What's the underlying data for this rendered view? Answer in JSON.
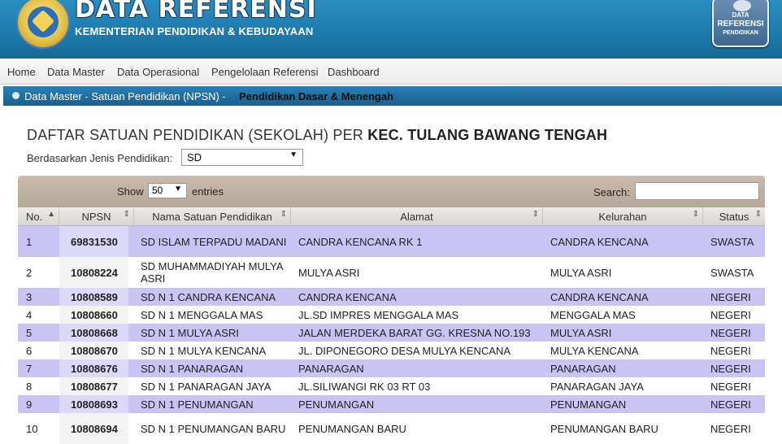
{
  "header": {
    "title": "DATA REFERENSI",
    "subtitle": "KEMENTERIAN PENDIDIKAN & KEBUDAYAAN",
    "badge": {
      "line1": "DATA",
      "line2": "REFERENSI",
      "line3": "PENDIDIKAN"
    }
  },
  "nav": {
    "items": [
      "Home",
      "Data Master",
      "Data Operasional",
      "Pengelolaan Referensi",
      "Dashboard"
    ]
  },
  "breadcrumb": {
    "path": "Data Master - Satuan Pendidikan (NPSN) -",
    "current": "Pendidikan Dasar & Menengah"
  },
  "page": {
    "title_prefix": "DAFTAR SATUAN PENDIDIKAN (SEKOLAH) PER",
    "title_strong": "KEC. TULANG BAWANG TENGAH",
    "filter_label": "Berdasarkan Jenis Pendidikan:",
    "filter_value": "SD"
  },
  "table_controls": {
    "show_label": "Show",
    "show_value": "50",
    "entries_label": "entries",
    "search_label": "Search:",
    "search_value": ""
  },
  "table": {
    "headers": [
      "No.",
      "NPSN",
      "Nama Satuan Pendidikan",
      "Alamat",
      "Kelurahan",
      "Status"
    ],
    "rows": [
      {
        "no": "1",
        "npsn": "69831530",
        "nama": "SD ISLAM TERPADU MADANI",
        "alamat": "CANDRA KENCANA RK 1",
        "kelurahan": "CANDRA KENCANA",
        "status": "SWASTA"
      },
      {
        "no": "2",
        "npsn": "10808224",
        "nama": "SD MUHAMMADIYAH MULYA ASRI",
        "alamat": "MULYA ASRI",
        "kelurahan": "MULYA ASRI",
        "status": "SWASTA"
      },
      {
        "no": "3",
        "npsn": "10808589",
        "nama": "SD N 1 CANDRA KENCANA",
        "alamat": "CANDRA KENCANA",
        "kelurahan": "CANDRA KENCANA",
        "status": "NEGERI"
      },
      {
        "no": "4",
        "npsn": "10808660",
        "nama": "SD N 1 MENGGALA MAS",
        "alamat": "JL.SD IMPRES MENGGALA MAS",
        "kelurahan": "MENGGALA MAS",
        "status": "NEGERI"
      },
      {
        "no": "5",
        "npsn": "10808668",
        "nama": "SD N 1 MULYA ASRI",
        "alamat": "JALAN MERDEKA BARAT GG. KRESNA NO.193",
        "kelurahan": "MULYA ASRI",
        "status": "NEGERI"
      },
      {
        "no": "6",
        "npsn": "10808670",
        "nama": "SD N 1 MULYA KENCANA",
        "alamat": "JL. DIPONEGORO DESA MULYA KENCANA",
        "kelurahan": "MULYA KENCANA",
        "status": "NEGERI"
      },
      {
        "no": "7",
        "npsn": "10808676",
        "nama": "SD N 1 PANARAGAN",
        "alamat": "PANARAGAN",
        "kelurahan": "PANARAGAN",
        "status": "NEGERI"
      },
      {
        "no": "8",
        "npsn": "10808677",
        "nama": "SD N 1 PANARAGAN JAYA",
        "alamat": "JL.SILIWANGI RK 03 RT 03",
        "kelurahan": "PANARAGAN JAYA",
        "status": "NEGERI"
      },
      {
        "no": "9",
        "npsn": "10808693",
        "nama": "SD N 1 PENUMANGAN",
        "alamat": "PENUMANGAN",
        "kelurahan": "PENUMANGAN",
        "status": "NEGERI"
      },
      {
        "no": "10",
        "npsn": "10808694",
        "nama": "SD N 1 PENUMANGAN BARU",
        "alamat": "PENUMANGAN BARU",
        "kelurahan": "PENUMANGAN BARU",
        "status": "NEGERI"
      }
    ]
  },
  "colors": {
    "header_blue": "#1d79ab",
    "row_odd": "#c9c4f2",
    "row_even": "#ffffff",
    "table_top": "#b6a898"
  }
}
